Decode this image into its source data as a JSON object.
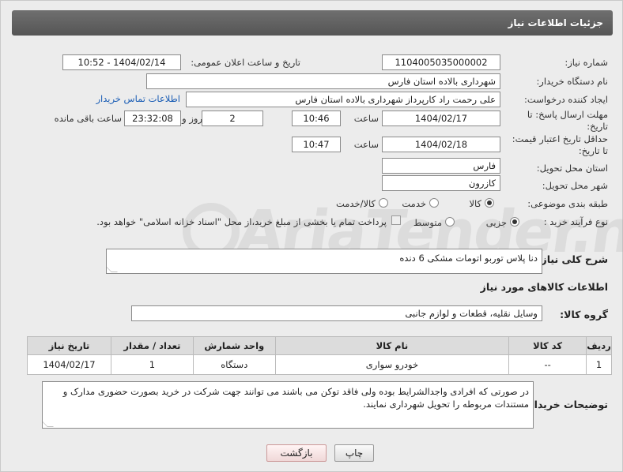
{
  "header": {
    "title": "جزئیات اطلاعات نیاز"
  },
  "need_number": {
    "label": "شماره نیاز:",
    "value": "1104005035000002"
  },
  "announce": {
    "label": "تاریخ و ساعت اعلان عمومی:",
    "value": "1404/02/14 - 10:52"
  },
  "buyer_org": {
    "label": "نام دستگاه خریدار:",
    "value": "شهرداری بالاده استان فارس"
  },
  "creator": {
    "label": "ایجاد کننده درخواست:",
    "value": "علی رحمت راد کارپرداز شهرداری بالاده استان فارس",
    "contact_link": "اطلاعات تماس خریدار"
  },
  "deadline": {
    "label_line1": "مهلت ارسال پاسخ: تا",
    "label_line2": "تاریخ:",
    "date": "1404/02/17",
    "time_label": "ساعت",
    "time": "10:46",
    "days": "2",
    "days_label": "روز و",
    "remaining": "23:32:08",
    "remaining_label": "ساعت باقی مانده"
  },
  "price_validity": {
    "label_line1": "حداقل تاریخ اعتبار قیمت:",
    "label_line2": "تا تاریخ:",
    "date": "1404/02/18",
    "time_label": "ساعت",
    "time": "10:47"
  },
  "province": {
    "label": "استان محل تحویل:",
    "value": "فارس"
  },
  "city": {
    "label": "شهر محل تحویل:",
    "value": "کازرون"
  },
  "category": {
    "label": "طبقه بندی موضوعی:",
    "options": [
      "کالا",
      "خدمت",
      "کالا/خدمت"
    ],
    "selected": "کالا"
  },
  "process": {
    "label": "نوع فرآیند خرید :",
    "options": [
      "جزیی",
      "متوسط"
    ],
    "selected": "جزیی",
    "payment_note": "پرداخت تمام یا بخشی از مبلغ خرید،از محل \"اسناد خزانه اسلامی\" خواهد بود."
  },
  "description": {
    "label": "شرح کلی نیاز:",
    "value": "دنا پلاس توربو اتومات مشکی 6 دنده"
  },
  "goods_info": {
    "title": "اطلاعات کالاهای مورد نیاز"
  },
  "goods_group": {
    "label": "گروه کالا:",
    "value": "وسایل نقلیه، قطعات و لوازم جانبی"
  },
  "table": {
    "headers": [
      "ردیف",
      "کد کالا",
      "نام کالا",
      "واحد شمارش",
      "تعداد / مقدار",
      "تاریخ نیاز"
    ],
    "rows": [
      [
        "1",
        "--",
        "خودرو سواری",
        "دستگاه",
        "1",
        "1404/02/17"
      ]
    ]
  },
  "buyer_notes": {
    "label": "توضیحات خریدار:",
    "value": "در صورتی که افرادی واجدالشرایط بوده ولی فاقد توکن می باشند می توانند جهت شرکت در خرید بصورت حضوری مدارک و مستندات مربوطه را تحویل شهرداری نمایند."
  },
  "buttons": {
    "print": "چاپ",
    "back": "بازگشت"
  },
  "watermark": {
    "text": "AriaTender.neT"
  }
}
